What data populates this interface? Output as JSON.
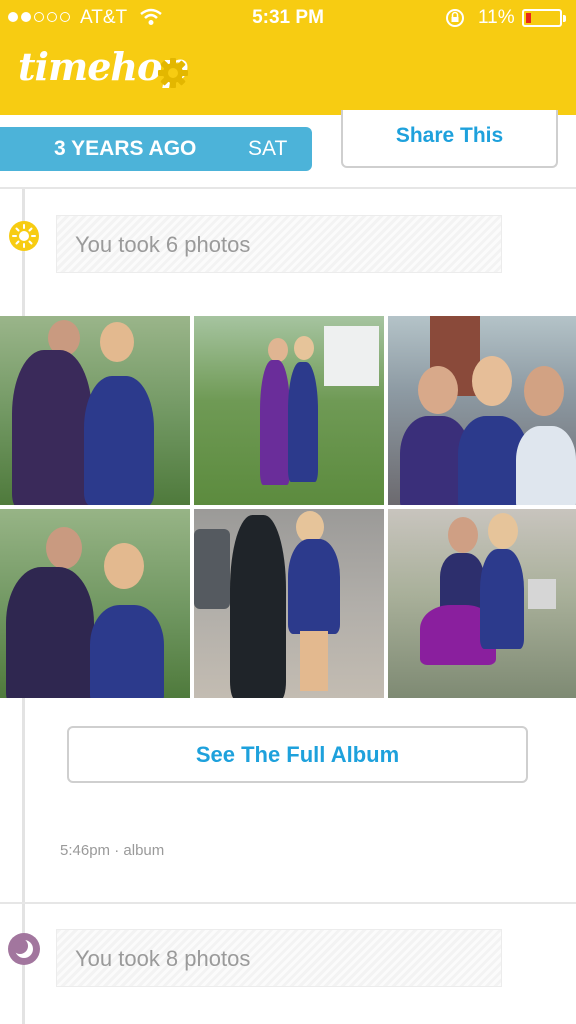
{
  "status_bar": {
    "carrier": "AT&T",
    "time": "5:31 PM",
    "battery_percent": "11%",
    "signal_bars_filled": 2,
    "signal_bars_total": 5,
    "icons": [
      "wifi-icon",
      "rotation-lock-icon",
      "battery-icon"
    ]
  },
  "header": {
    "logo_text": "timehop",
    "settings_icon": "gear-icon",
    "bg_color": "#f7cc12"
  },
  "date_bar": {
    "years_ago": "3 YEARS AGO",
    "day": "SAT",
    "share_label": "Share This",
    "accent": "#4cb3d9"
  },
  "entries": [
    {
      "icon": "sun-icon",
      "label": "You took 6 photos",
      "photos": [
        "photo-1",
        "photo-2",
        "photo-3",
        "photo-4",
        "photo-5",
        "photo-6"
      ],
      "album_button": "See The Full Album",
      "time": "5:46pm",
      "type": "album"
    },
    {
      "icon": "moon-icon",
      "label": "You took 8 photos"
    }
  ],
  "colors": {
    "link_blue": "#1ea1dc",
    "muted_text": "#9a9a9a",
    "night_icon": "#a2769e"
  }
}
